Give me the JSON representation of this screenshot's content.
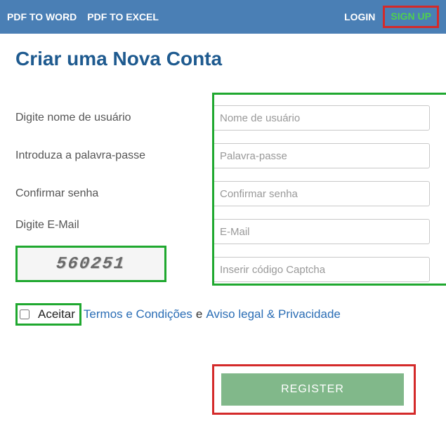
{
  "topbar": {
    "nav": [
      "PDF TO WORD",
      "PDF TO EXCEL"
    ],
    "login": "LOGIN",
    "signup": "SIGN UP"
  },
  "title": "Criar uma Nova Conta",
  "form": {
    "username_label": "Digite nome de usuário",
    "username_placeholder": "Nome de usuário",
    "password_label": "Introduza a palavra-passe",
    "password_placeholder": "Palavra-passe",
    "confirm_label": "Confirmar senha",
    "confirm_placeholder": "Confirmar senha",
    "email_label": "Digite E-Mail",
    "email_placeholder": "E-Mail",
    "captcha_placeholder": "Inserir código Captcha",
    "captcha_value": "560251"
  },
  "terms": {
    "accept": "Aceitar",
    "terms_link": "Termos e Condições",
    "sep": "e",
    "privacy_link": "Aviso legal & Privacidade"
  },
  "register_button": "REGISTER",
  "colors": {
    "topbar_bg": "#4a7fb5",
    "accent_green": "#1fa82f",
    "accent_red": "#d42a2a",
    "title_blue": "#1e5a8f",
    "link_blue": "#2a6db5",
    "button_green": "#81b88a",
    "signup_green": "#4fd04f"
  }
}
